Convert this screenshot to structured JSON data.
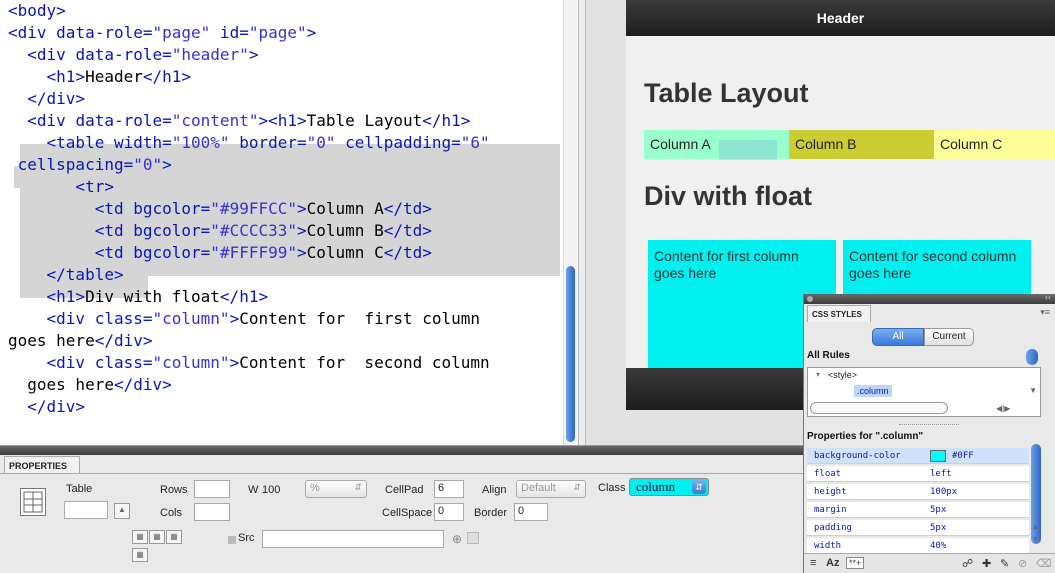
{
  "code_view": {
    "lines": [
      [
        {
          "t": "<body>",
          "c": "tg"
        }
      ],
      [
        {
          "t": "<div ",
          "c": "tg"
        },
        {
          "t": "data-role=",
          "c": "at"
        },
        {
          "t": "\"page\"",
          "c": "av"
        },
        {
          "t": " id=",
          "c": "at"
        },
        {
          "t": "\"page\"",
          "c": "av"
        },
        {
          "t": ">",
          "c": "tg"
        }
      ],
      [
        {
          "t": "  <div ",
          "c": "tg"
        },
        {
          "t": "data-role=",
          "c": "at"
        },
        {
          "t": "\"header\"",
          "c": "av"
        },
        {
          "t": ">",
          "c": "tg"
        }
      ],
      [
        {
          "t": "    <h1>",
          "c": "tg"
        },
        {
          "t": "Header",
          "c": ""
        },
        {
          "t": "</h1>",
          "c": "tg"
        }
      ],
      [
        {
          "t": "  </div>",
          "c": "tg"
        }
      ],
      [
        {
          "t": "  <div ",
          "c": "tg"
        },
        {
          "t": "data-role=",
          "c": "at"
        },
        {
          "t": "\"content\"",
          "c": "av"
        },
        {
          "t": "><h1>",
          "c": "tg"
        },
        {
          "t": "Table Layout",
          "c": ""
        },
        {
          "t": "</h1>",
          "c": "tg"
        }
      ],
      [
        {
          "t": "    <table ",
          "c": "tg"
        },
        {
          "t": "width=",
          "c": "at"
        },
        {
          "t": "\"100%\"",
          "c": "av"
        },
        {
          "t": " border=",
          "c": "at"
        },
        {
          "t": "\"0\"",
          "c": "av"
        },
        {
          "t": " cellpadding=",
          "c": "at"
        },
        {
          "t": "\"6\"",
          "c": "av"
        }
      ],
      [
        {
          "t": " cellspacing=",
          "c": "at"
        },
        {
          "t": "\"0\"",
          "c": "av"
        },
        {
          "t": ">",
          "c": "tg"
        }
      ],
      [
        {
          "t": "       <tr>",
          "c": "tg"
        }
      ],
      [
        {
          "t": "         <td ",
          "c": "tg"
        },
        {
          "t": "bgcolor=",
          "c": "at"
        },
        {
          "t": "\"#99FFCC\"",
          "c": "av"
        },
        {
          "t": ">",
          "c": "tg"
        },
        {
          "t": "Column A",
          "c": ""
        },
        {
          "t": "</td>",
          "c": "tg"
        }
      ],
      [
        {
          "t": "         <td ",
          "c": "tg"
        },
        {
          "t": "bgcolor=",
          "c": "at"
        },
        {
          "t": "\"#CCCC33\"",
          "c": "av"
        },
        {
          "t": ">",
          "c": "tg"
        },
        {
          "t": "Column B",
          "c": ""
        },
        {
          "t": "</td>",
          "c": "tg"
        }
      ],
      [
        {
          "t": "         <td ",
          "c": "tg"
        },
        {
          "t": "bgcolor=",
          "c": "at"
        },
        {
          "t": "\"#FFFF99\"",
          "c": "av"
        },
        {
          "t": ">",
          "c": "tg"
        },
        {
          "t": "Column C",
          "c": ""
        },
        {
          "t": "</td>",
          "c": "tg"
        }
      ],
      [
        {
          "t": "    </table>",
          "c": "tg"
        }
      ],
      [
        {
          "t": "    <h1>",
          "c": "tg"
        },
        {
          "t": "Div with float",
          "c": ""
        },
        {
          "t": "</h1>",
          "c": "tg"
        }
      ],
      [
        {
          "t": "    <div ",
          "c": "tg"
        },
        {
          "t": "class=",
          "c": "at"
        },
        {
          "t": "\"column\"",
          "c": "av"
        },
        {
          "t": ">",
          "c": "tg"
        },
        {
          "t": "Content for  first column",
          "c": ""
        }
      ],
      [
        {
          "t": "goes here",
          "c": ""
        },
        {
          "t": "</div>",
          "c": "tg"
        }
      ],
      [
        {
          "t": "    <div ",
          "c": "tg"
        },
        {
          "t": "class=",
          "c": "at"
        },
        {
          "t": "\"column\"",
          "c": "av"
        },
        {
          "t": ">",
          "c": "tg"
        },
        {
          "t": "Content for  second column",
          "c": ""
        }
      ],
      [
        {
          "t": "  goes here",
          "c": ""
        },
        {
          "t": "</div>",
          "c": "tg"
        }
      ],
      [
        {
          "t": "  </div>",
          "c": "tg"
        }
      ]
    ]
  },
  "design_view": {
    "header": "Header",
    "h1_table": "Table Layout",
    "columns": [
      {
        "label": "Column A",
        "color": "#99FFCC"
      },
      {
        "label": "Column B",
        "color": "#CCCC33"
      },
      {
        "label": "Column C",
        "color": "#FFFF99"
      }
    ],
    "h1_float": "Div with float",
    "col1": "Content for first column goes here",
    "col2": "Content for second column goes here"
  },
  "properties": {
    "tab": "PROPERTIES",
    "table_label": "Table",
    "rows_label": "Rows",
    "cols_label": "Cols",
    "w_label": "W",
    "w_value": "100",
    "w_unit": "%",
    "cellpad_label": "CellPad",
    "cellpad_value": "6",
    "cellspace_label": "CellSpace",
    "cellspace_value": "0",
    "align_label": "Align",
    "align_value": "Default",
    "border_label": "Border",
    "border_value": "0",
    "class_label": "Class",
    "class_value": "column",
    "src_label": "Src"
  },
  "css_styles": {
    "tab": "CSS STYLES",
    "seg_all": "All",
    "seg_current": "Current",
    "all_rules": "All Rules",
    "rule_parent": "<style>",
    "rule_selected": ".column",
    "props_for": "Properties for \".column\"",
    "props": [
      {
        "name": "background-color",
        "value": "#0FF",
        "swatch": "#00FFFF"
      },
      {
        "name": "float",
        "value": "left"
      },
      {
        "name": "height",
        "value": "100px"
      },
      {
        "name": "margin",
        "value": "5px"
      },
      {
        "name": "padding",
        "value": "5px"
      },
      {
        "name": "width",
        "value": "40%"
      }
    ]
  }
}
